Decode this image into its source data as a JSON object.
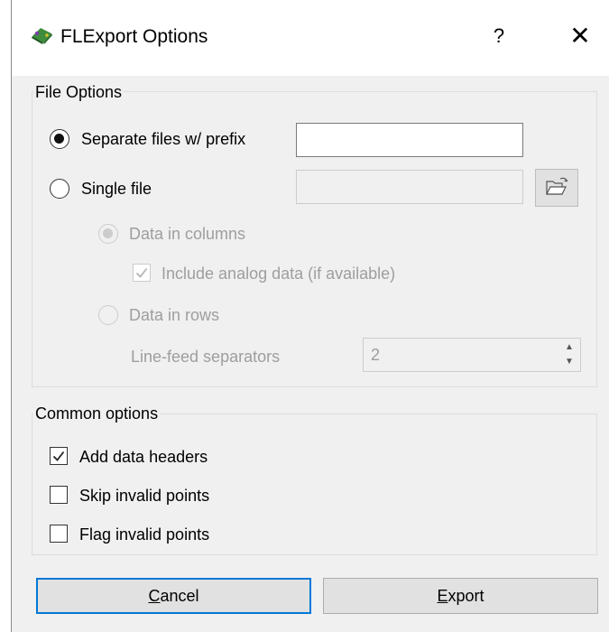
{
  "window": {
    "title": "FLExport Options",
    "help_label": "?",
    "close_label": "✕"
  },
  "file_options": {
    "group_title": "File Options",
    "separate_files": {
      "label": "Separate files w/ prefix",
      "checked": true,
      "prefix_value": ""
    },
    "single_file": {
      "label": "Single file",
      "checked": false,
      "path_value": ""
    },
    "data_in_columns": {
      "label": "Data in columns",
      "checked": true,
      "enabled": false
    },
    "include_analog": {
      "label": "Include analog data (if available)",
      "checked": true,
      "enabled": false
    },
    "data_in_rows": {
      "label": "Data in rows",
      "checked": false,
      "enabled": false
    },
    "line_feed": {
      "label": "Line-feed separators",
      "value": "2",
      "enabled": false
    }
  },
  "common_options": {
    "group_title": "Common options",
    "add_headers": {
      "label": "Add data headers",
      "checked": true
    },
    "skip_invalid": {
      "label": "Skip invalid points",
      "checked": false
    },
    "flag_invalid": {
      "label": "Flag invalid points",
      "checked": false
    }
  },
  "buttons": {
    "cancel": {
      "mnemonic": "C",
      "rest": "ancel"
    },
    "export": {
      "mnemonic": "E",
      "rest": "xport"
    }
  },
  "colors": {
    "accent": "#0078d7",
    "disabled_text": "#9e9e9e"
  }
}
